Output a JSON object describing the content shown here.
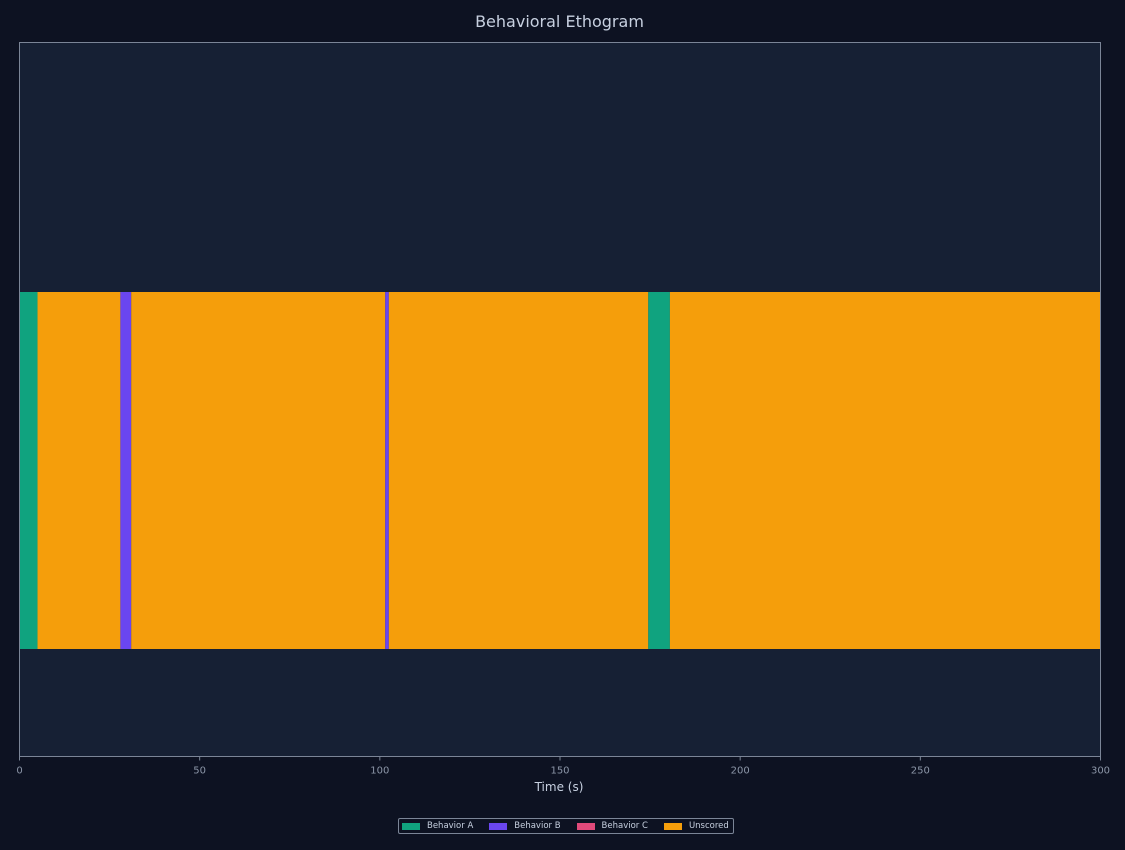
{
  "chart_data": {
    "type": "bar",
    "title": "Behavioral Ethogram",
    "xlabel": "Time (s)",
    "ylabel": "",
    "xlim": [
      0,
      300
    ],
    "xticks": [
      "0",
      "50",
      "100",
      "150",
      "200",
      "250",
      "300"
    ],
    "tick_values": [
      0,
      50,
      100,
      150,
      200,
      250,
      300
    ],
    "legend_position": "bottom-center",
    "grid": false,
    "categories": [
      "Behavior A",
      "Behavior B",
      "Behavior C",
      "Unscored"
    ],
    "colors": {
      "Behavior A": "#10a37f",
      "Behavior B": "#6a46f0",
      "Behavior C": "#e14a7b",
      "Unscored": "#f59e0b",
      "background": "#0d1222",
      "plot_area": "#162034"
    },
    "segments": [
      {
        "behavior": "Behavior A",
        "start": 0,
        "end": 5
      },
      {
        "behavior": "Unscored",
        "start": 5,
        "end": 28
      },
      {
        "behavior": "Behavior B",
        "start": 28,
        "end": 31
      },
      {
        "behavior": "Unscored",
        "start": 31,
        "end": 101.5
      },
      {
        "behavior": "Behavior B",
        "start": 101.5,
        "end": 102.5
      },
      {
        "behavior": "Unscored",
        "start": 102.5,
        "end": 174.5
      },
      {
        "behavior": "Behavior A",
        "start": 174.5,
        "end": 180.5
      },
      {
        "behavior": "Unscored",
        "start": 180.5,
        "end": 300
      }
    ]
  }
}
